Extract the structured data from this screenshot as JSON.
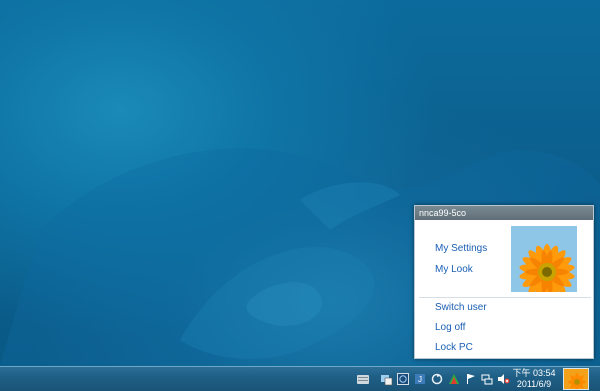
{
  "flyout": {
    "username": "nnca99-5co",
    "links": {
      "my_settings": "My Settings",
      "my_look": "My Look",
      "switch_user": "Switch user",
      "log_off": "Log off",
      "lock_pc": "Lock PC"
    }
  },
  "taskbar": {
    "clock_time": "下午 03:54",
    "clock_date": "2011/6/9",
    "tray_icons": [
      "keyboard-icon",
      "network-app-icon",
      "clock-app-icon",
      "java-icon",
      "sync-icon",
      "app-tree-icon",
      "flag-icon",
      "network-icon",
      "volume-muted-icon"
    ]
  },
  "colors": {
    "desktop": "#0b5d8b",
    "taskbar": "#1f5f86",
    "link": "#1a5fb4",
    "flower": "#f29a12"
  }
}
